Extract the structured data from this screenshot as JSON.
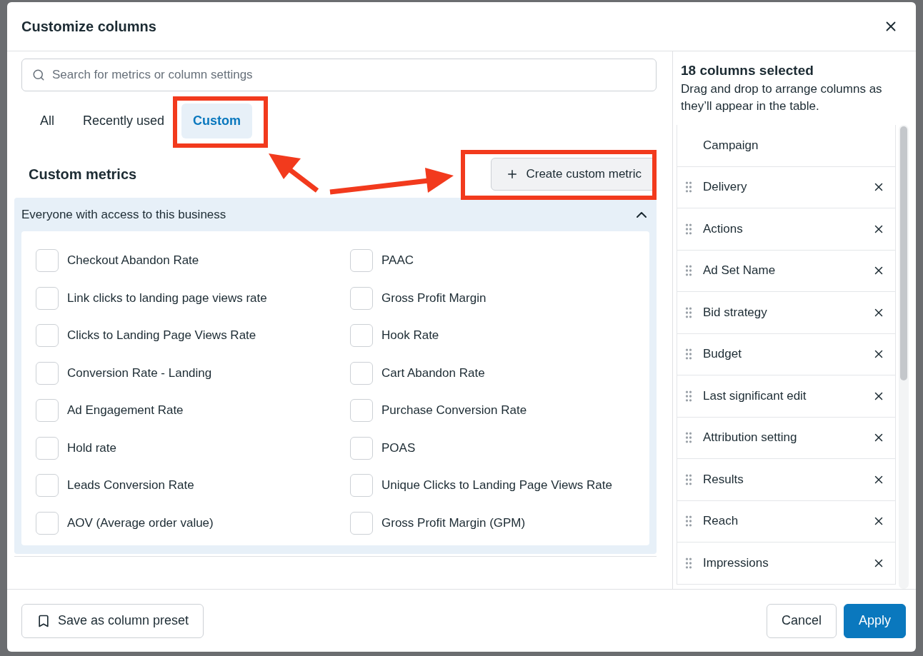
{
  "dialog": {
    "title": "Customize columns"
  },
  "search": {
    "placeholder": "Search for metrics or column settings"
  },
  "tabs": [
    {
      "label": "All",
      "selected": false
    },
    {
      "label": "Recently used",
      "selected": false
    },
    {
      "label": "Custom",
      "selected": true
    }
  ],
  "section": {
    "heading": "Custom metrics",
    "create_button": "Create custom metric"
  },
  "group": {
    "title": "Everyone with access to this business",
    "expanded": true,
    "items": [
      {
        "label": "Checkout Abandon Rate",
        "checked": false
      },
      {
        "label": "PAAC",
        "checked": false
      },
      {
        "label": "Link clicks to landing page views rate",
        "checked": false
      },
      {
        "label": "Gross Profit Margin",
        "checked": false
      },
      {
        "label": "Clicks to Landing Page Views Rate",
        "checked": false
      },
      {
        "label": "Hook Rate",
        "checked": false
      },
      {
        "label": "Conversion Rate - Landing",
        "checked": false
      },
      {
        "label": "Cart Abandon Rate",
        "checked": false
      },
      {
        "label": "Ad Engagement Rate",
        "checked": false
      },
      {
        "label": "Purchase Conversion Rate",
        "checked": false
      },
      {
        "label": "Hold rate",
        "checked": false
      },
      {
        "label": "POAS",
        "checked": false
      },
      {
        "label": "Leads Conversion Rate",
        "checked": false
      },
      {
        "label": "Unique Clicks to Landing Page Views Rate",
        "checked": false
      },
      {
        "label": "AOV (Average order value)",
        "checked": false
      },
      {
        "label": "Gross Profit Margin (GPM)",
        "checked": false
      }
    ]
  },
  "selected_panel": {
    "title": "18 columns selected",
    "description": "Drag and drop to arrange columns as they’ll appear in the table.",
    "columns": [
      {
        "label": "Campaign",
        "kind": "fixed"
      },
      {
        "label": "Delivery",
        "kind": "movable"
      },
      {
        "label": "Actions",
        "kind": "movable"
      },
      {
        "label": "Ad Set Name",
        "kind": "movable"
      },
      {
        "label": "Bid strategy",
        "kind": "movable"
      },
      {
        "label": "Budget",
        "kind": "movable"
      },
      {
        "label": "Last significant edit",
        "kind": "movable"
      },
      {
        "label": "Attribution setting",
        "kind": "movable"
      },
      {
        "label": "Results",
        "kind": "movable"
      },
      {
        "label": "Reach",
        "kind": "movable"
      },
      {
        "label": "Impressions",
        "kind": "movable"
      }
    ]
  },
  "footer": {
    "preset_button": "Save as column preset",
    "cancel_button": "Cancel",
    "apply_button": "Apply"
  }
}
